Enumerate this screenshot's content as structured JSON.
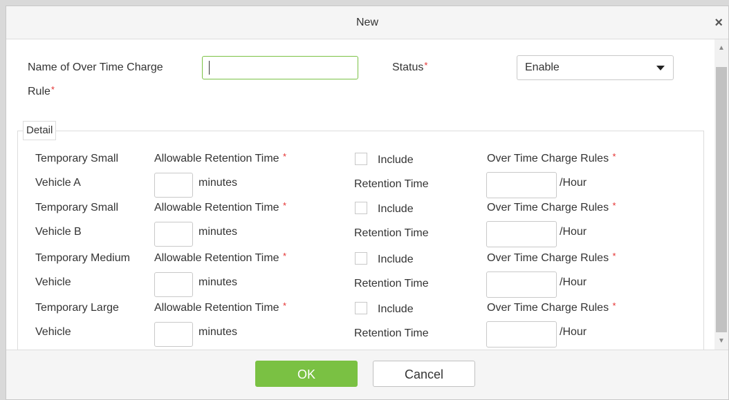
{
  "dialog": {
    "title": "New",
    "close_icon": "×",
    "required_mark": "*",
    "name_label_line1": "Name of Over Time Charge",
    "name_label_line2": "Rule",
    "name_value": "",
    "status_label": "Status",
    "status_value": "Enable",
    "detail_legend": "Detail",
    "ok_label": "OK",
    "cancel_label": "Cancel"
  },
  "common": {
    "retention_label": "Allowable Retention Time",
    "minutes_label": "minutes",
    "include_label": "Include",
    "retention_time_label": "Retention Time",
    "charge_label": "Over Time Charge Rules",
    "per_hour_label": "/Hour"
  },
  "vehicles": [
    {
      "line1": "Temporary Small",
      "line2": "Vehicle A",
      "retention_value": "",
      "include_checked": false,
      "charge_value": ""
    },
    {
      "line1": "Temporary Small",
      "line2": "Vehicle B",
      "retention_value": "",
      "include_checked": false,
      "charge_value": ""
    },
    {
      "line1": "Temporary Medium",
      "line2": "Vehicle",
      "retention_value": "",
      "include_checked": false,
      "charge_value": ""
    },
    {
      "line1": "Temporary Large",
      "line2": "Vehicle",
      "retention_value": "",
      "include_checked": false,
      "charge_value": ""
    }
  ],
  "colors": {
    "accent": "#7ac143",
    "required": "#e43030"
  }
}
